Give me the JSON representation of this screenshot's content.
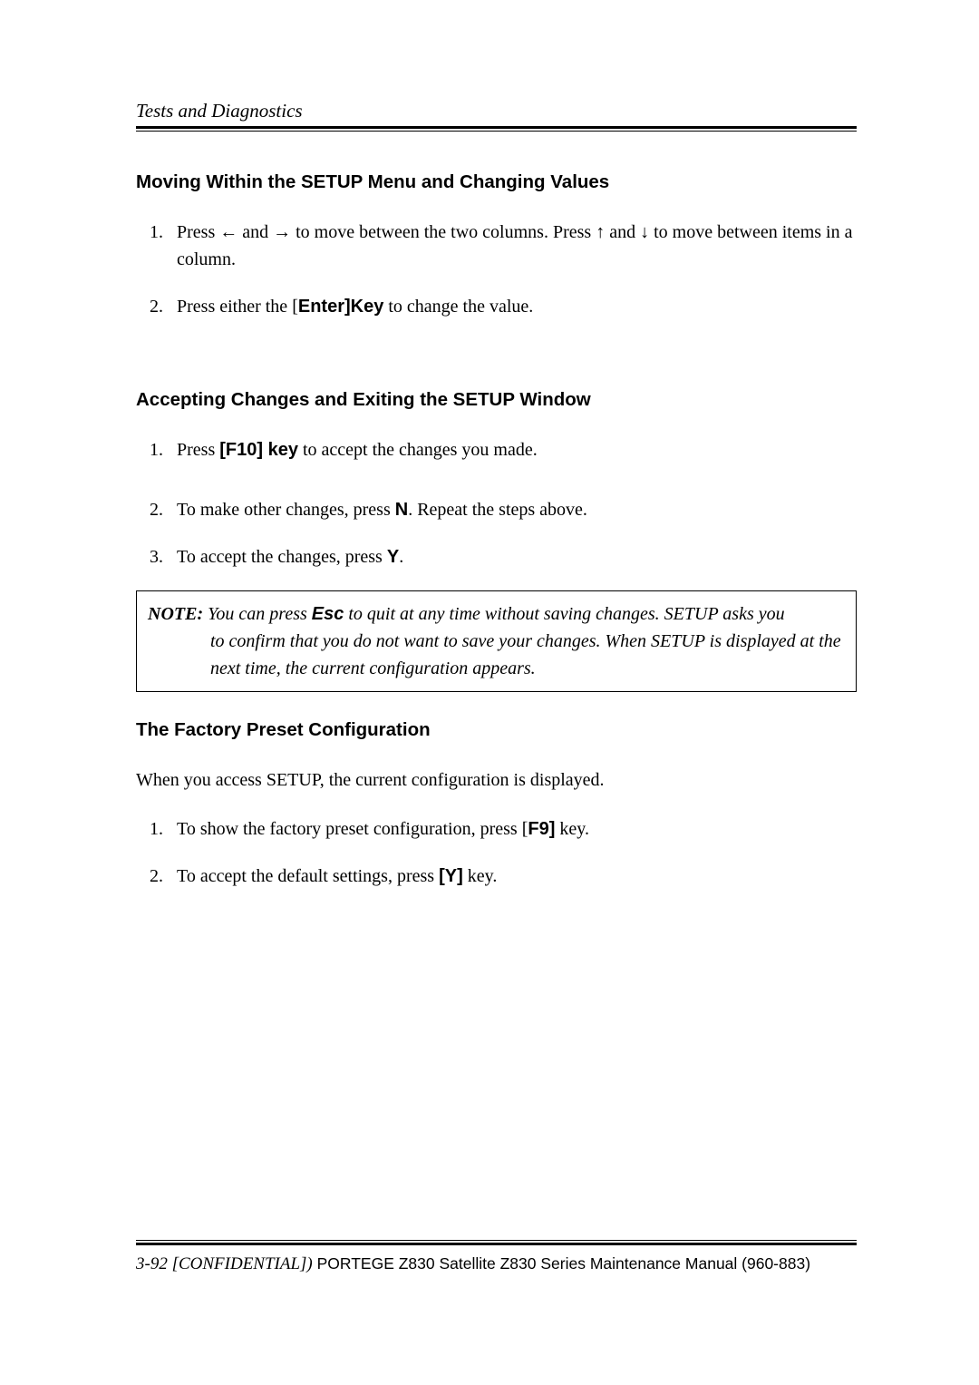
{
  "header": {
    "title": "Tests and Diagnostics"
  },
  "sections": {
    "moving": {
      "heading": "Moving Within the SETUP Menu and Changing Values",
      "item1_pre": "Press ",
      "item1_mid1": " and ",
      "item1_mid2": " to move between the two columns. Press ",
      "item1_mid3": " and ",
      "item1_post": " to move between items in a column.",
      "item2_pre": "Press either the [",
      "item2_key": "Enter]Key",
      "item2_post": " to change the value."
    },
    "accepting": {
      "heading": "Accepting Changes and Exiting the SETUP Window",
      "item1_pre": "Press ",
      "item1_key": "[F10] key",
      "item1_post": " to accept the changes you made.",
      "item2_pre": "To make other changes, press ",
      "item2_key": "N",
      "item2_post": ". Repeat the steps above.",
      "item3_pre": "To accept the changes, press ",
      "item3_key": "Y",
      "item3_post": "."
    },
    "note": {
      "label": "NOTE:",
      "line1a": " You can press ",
      "esc": "Esc",
      "line1b": " to quit at any time without saving changes. SETUP asks you",
      "line2": "to confirm that you do not want to save your changes. When SETUP is displayed at the next time, the current configuration appears."
    },
    "factory": {
      "heading": "The Factory Preset Configuration",
      "intro": "When you access SETUP, the current configuration is displayed.",
      "item1_pre": "To show the factory preset configuration, press [",
      "item1_key": "F9]",
      "item1_post": " key.",
      "item2_pre": "To accept the default settings, press ",
      "item2_key": "[Y]",
      "item2_post": " key."
    }
  },
  "arrows": {
    "left": "←",
    "right": "→",
    "up": "↑",
    "down": "↓"
  },
  "footer": {
    "pagecode": "3-92 [CONFIDENTIAL])",
    "manual": " PORTEGE Z830 Satellite Z830 Series Maintenance Manual (960-883)"
  }
}
